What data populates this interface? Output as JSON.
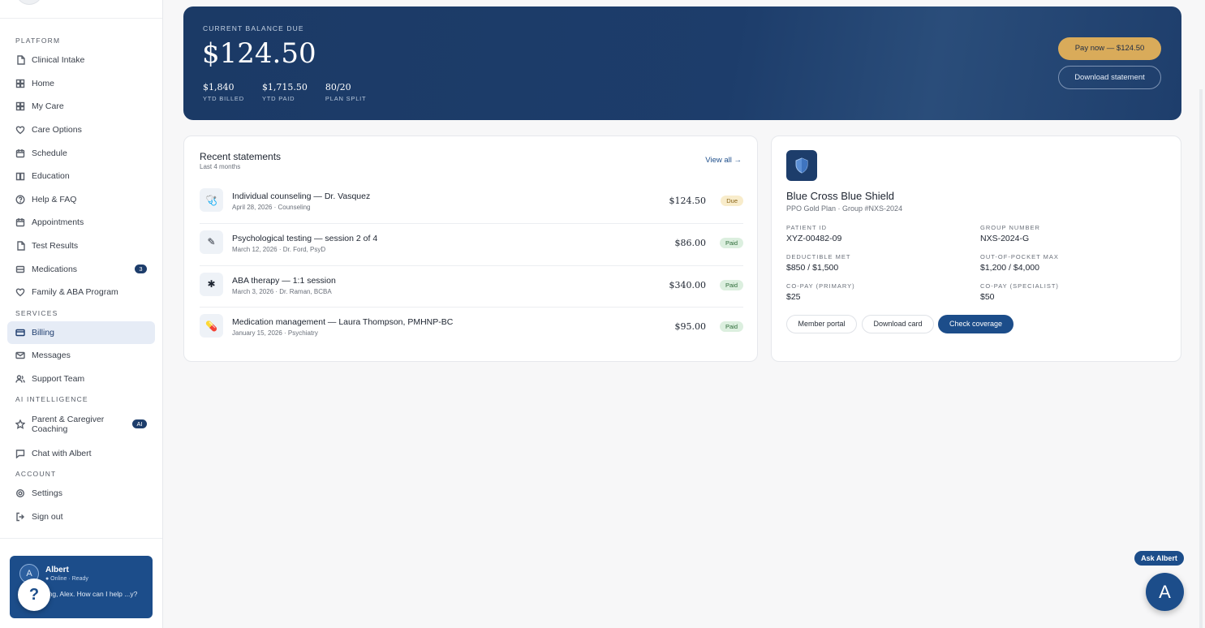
{
  "sidebar": {
    "sections": {
      "platform": "PLATFORM",
      "services": "SERVICES",
      "ai": "AI INTELLIGENCE",
      "account": "ACCOUNT"
    },
    "platform_items": [
      {
        "label": "Clinical Intake",
        "icon": "document-icon"
      },
      {
        "label": "Home",
        "icon": "grid-icon"
      },
      {
        "label": "My Care",
        "icon": "grid-icon"
      },
      {
        "label": "Care Options",
        "icon": "heart-icon"
      },
      {
        "label": "Schedule",
        "icon": "calendar-icon"
      },
      {
        "label": "Education",
        "icon": "book-icon"
      },
      {
        "label": "Help & FAQ",
        "icon": "help-icon"
      },
      {
        "label": "Appointments",
        "icon": "calendar-icon"
      },
      {
        "label": "Test Results",
        "icon": "document-icon"
      },
      {
        "label": "Medications",
        "icon": "pill-icon",
        "badge": "3"
      },
      {
        "label": "Family & ABA Program",
        "icon": "heart-icon"
      }
    ],
    "services_items": [
      {
        "label": "Billing",
        "icon": "card-icon",
        "active": true
      },
      {
        "label": "Messages",
        "icon": "mail-icon"
      },
      {
        "label": "Support Team",
        "icon": "users-icon"
      }
    ],
    "ai_items": [
      {
        "label": "Parent & Caregiver Coaching",
        "icon": "star-icon",
        "badge": "AI"
      },
      {
        "label": "Chat with Albert",
        "icon": "chat-icon"
      }
    ],
    "account_items": [
      {
        "label": "Settings",
        "icon": "gear-icon"
      },
      {
        "label": "Sign out",
        "icon": "sign-out-icon"
      }
    ]
  },
  "albert": {
    "avatar_letter": "A",
    "name": "Albert",
    "status": "● Online · Ready",
    "message": "...ning, Alex. How can I help ...y?"
  },
  "help_fab": "?",
  "hero": {
    "label": "CURRENT BALANCE DUE",
    "amount": "$124.50",
    "stats": [
      {
        "value": "$1,840",
        "label": "YTD BILLED"
      },
      {
        "value": "$1,715.50",
        "label": "YTD PAID"
      },
      {
        "value": "80/20",
        "label": "PLAN SPLIT"
      }
    ],
    "pay_button": "Pay now — $124.50",
    "download_button": "Download statement"
  },
  "statements": {
    "title": "Recent statements",
    "subtitle": "Last 4 months",
    "view_all": "View all →",
    "rows": [
      {
        "name": "Individual counseling — Dr. Vasquez",
        "meta": "April 28, 2026 · Counseling",
        "amount": "$124.50",
        "status": "Due",
        "icon": "🩺",
        "icon_name": "stethoscope-icon"
      },
      {
        "name": "Psychological testing — session 2 of 4",
        "meta": "March 12, 2026 · Dr. Ford, PsyD",
        "amount": "$86.00",
        "status": "Paid",
        "icon": "✎",
        "icon_name": "pencil-icon"
      },
      {
        "name": "ABA therapy — 1:1 session",
        "meta": "March 3, 2026 · Dr. Raman, BCBA",
        "amount": "$340.00",
        "status": "Paid",
        "icon": "✱",
        "icon_name": "puzzle-icon"
      },
      {
        "name": "Medication management — Laura Thompson, PMHNP-BC",
        "meta": "January 15, 2026 · Psychiatry",
        "amount": "$95.00",
        "status": "Paid",
        "icon": "💊",
        "icon_name": "pill-icon"
      }
    ]
  },
  "insurance": {
    "name": "Blue Cross Blue Shield",
    "plan": "PPO Gold Plan · Group #NXS-2024",
    "fields": [
      {
        "key": "PATIENT ID",
        "value": "XYZ-00482-09"
      },
      {
        "key": "GROUP NUMBER",
        "value": "NXS-2024-G"
      },
      {
        "key": "DEDUCTIBLE MET",
        "value": "$850 / $1,500"
      },
      {
        "key": "OUT-OF-POCKET MAX",
        "value": "$1,200 / $4,000"
      },
      {
        "key": "CO-PAY (PRIMARY)",
        "value": "$25"
      },
      {
        "key": "CO-PAY (SPECIALIST)",
        "value": "$50"
      }
    ],
    "buttons": {
      "member_portal": "Member portal",
      "download_card": "Download card",
      "check_coverage": "Check coverage"
    }
  },
  "ask_albert": {
    "pill": "Ask Albert",
    "fab_letter": "A"
  },
  "colors": {
    "brand_navy": "#1c4d8a",
    "hero_bg": "#1d3d6b",
    "gold": "#d9ab5a",
    "due_bg": "#f8eccb",
    "paid_bg": "#dcefdf"
  }
}
